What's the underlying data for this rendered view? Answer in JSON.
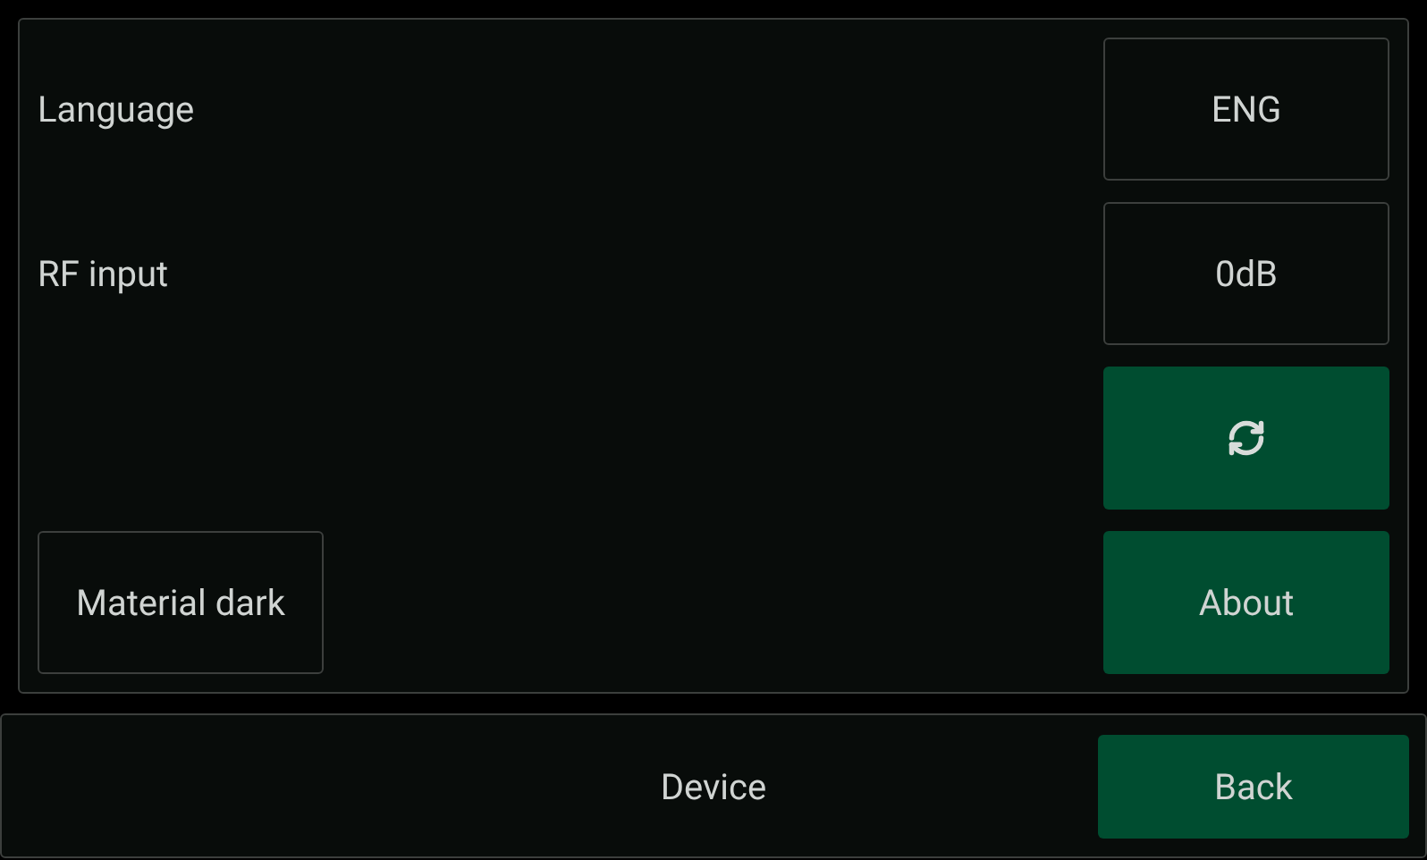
{
  "settings": [
    {
      "label": "Language",
      "action": {
        "kind": "option",
        "text": "ENG"
      }
    },
    {
      "label": "RF input",
      "action": {
        "kind": "option",
        "text": "0dB"
      }
    },
    {
      "action": {
        "kind": "icon"
      }
    },
    {
      "left": {
        "kind": "option",
        "text": "Material dark"
      },
      "action": {
        "kind": "action",
        "text": "About"
      }
    }
  ],
  "bottom_bar": {
    "title": "Device",
    "back": {
      "kind": "action",
      "text": "Back"
    }
  }
}
